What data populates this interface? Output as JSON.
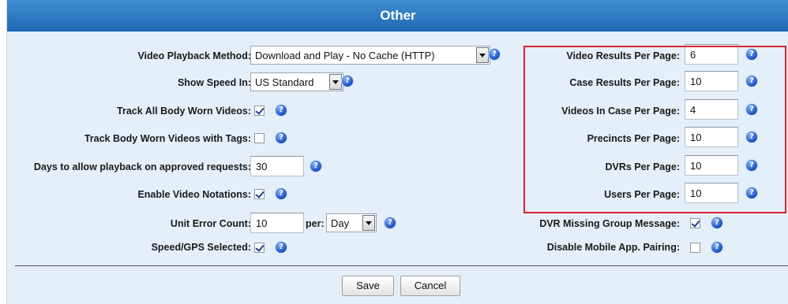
{
  "header": {
    "title": "Other"
  },
  "left": {
    "video_playback_method": {
      "label": "Video Playback Method:",
      "value": "Download and Play - No Cache (HTTP)"
    },
    "show_speed_in": {
      "label": "Show Speed In:",
      "value": "US Standard"
    },
    "track_all_body_worn": {
      "label": "Track All Body Worn Videos:",
      "checked": true
    },
    "track_body_worn_tags": {
      "label": "Track Body Worn Videos with Tags:",
      "checked": false
    },
    "days_playback": {
      "label": "Days to allow playback on approved requests:",
      "value": "30"
    },
    "enable_notations": {
      "label": "Enable Video Notations:",
      "checked": true
    },
    "unit_error_count": {
      "label": "Unit Error Count:",
      "value": "10",
      "per_label": "per:",
      "per_value": "Day"
    },
    "speed_gps": {
      "label": "Speed/GPS Selected:",
      "checked": true
    }
  },
  "right": {
    "video_results": {
      "label": "Video Results Per Page:",
      "value": "6"
    },
    "case_results": {
      "label": "Case Results Per Page:",
      "value": "10"
    },
    "videos_in_case": {
      "label": "Videos In Case Per Page:",
      "value": "4"
    },
    "precincts": {
      "label": "Precincts Per Page:",
      "value": "10"
    },
    "dvrs": {
      "label": "DVRs Per Page:",
      "value": "10"
    },
    "users": {
      "label": "Users Per Page:",
      "value": "10"
    },
    "dvr_missing_group": {
      "label": "DVR Missing Group Message:",
      "checked": true
    },
    "disable_mobile_pairing": {
      "label": "Disable Mobile App. Pairing:",
      "checked": false
    }
  },
  "help_glyph": "?",
  "buttons": {
    "save": "Save",
    "cancel": "Cancel"
  },
  "colors": {
    "header": "#2a78c2",
    "panel": "#e4effa",
    "highlight_box": "#d9252e"
  }
}
